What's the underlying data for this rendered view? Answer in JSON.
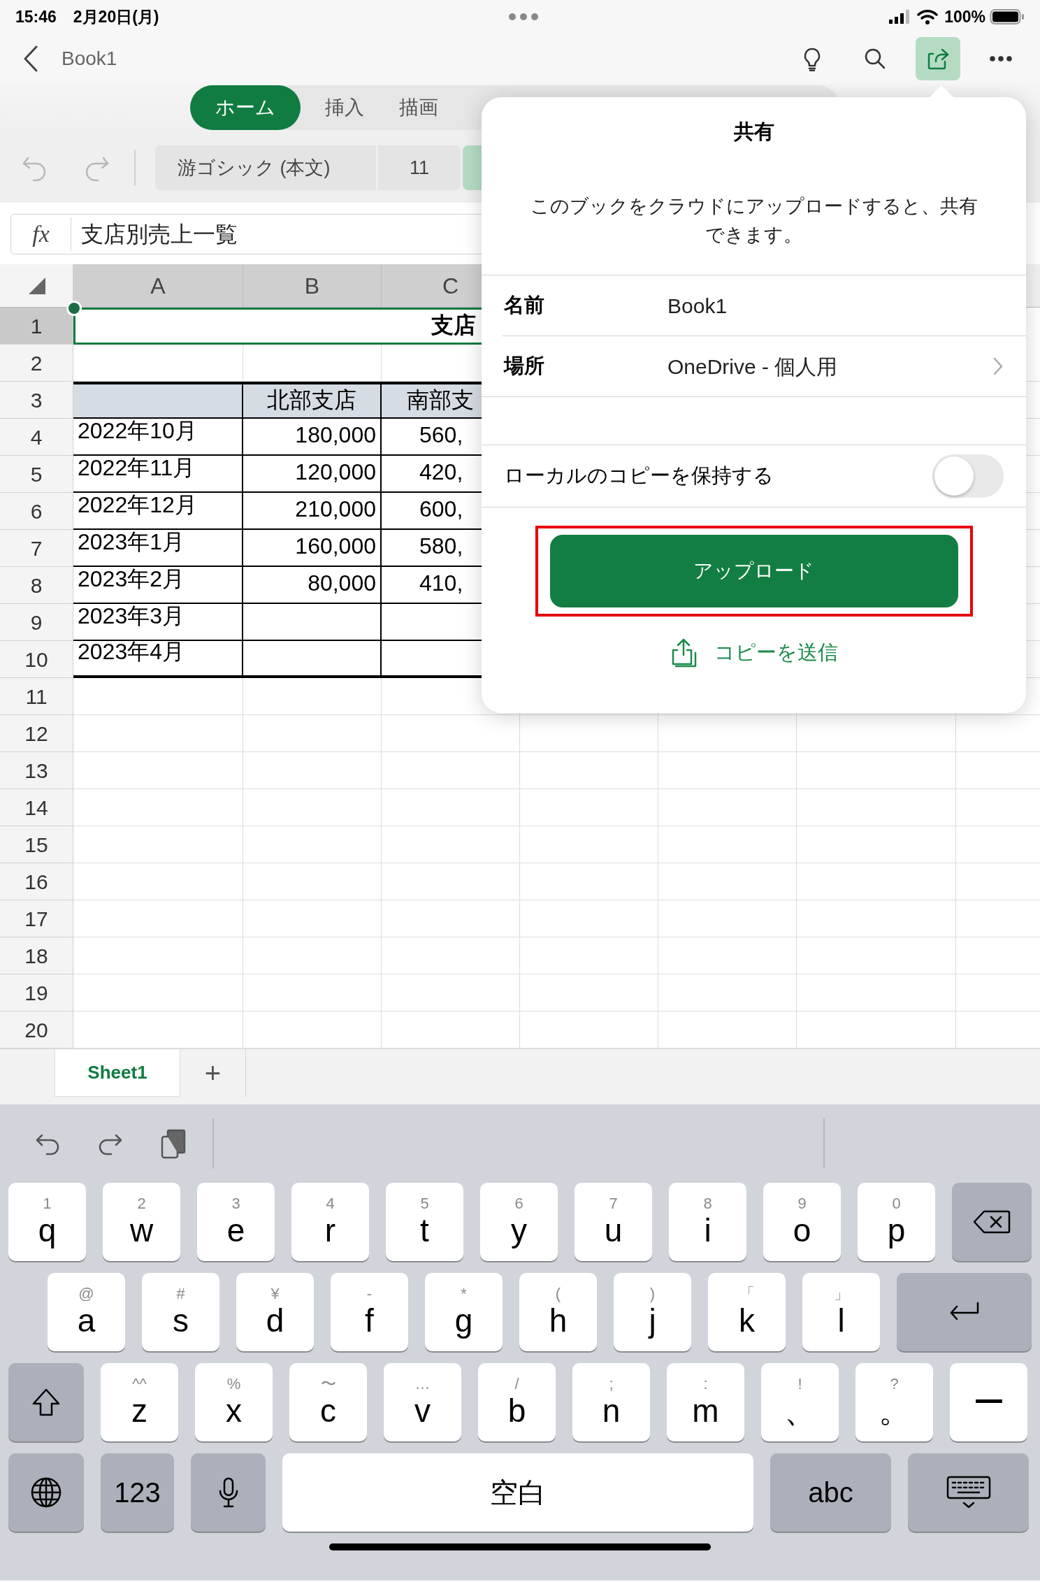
{
  "status_bar": {
    "time": "15:46",
    "date": "2月20日(月)",
    "battery": "100%"
  },
  "nav": {
    "title": "Book1",
    "buttons": [
      {
        "kind": "lightbulb",
        "selected": false
      },
      {
        "kind": "search",
        "selected": false
      },
      {
        "kind": "share",
        "selected": true
      },
      {
        "kind": "more",
        "selected": false
      }
    ]
  },
  "ribbon_tabs": [
    {
      "label": "ホーム",
      "selected": true
    },
    {
      "label": "挿入",
      "selected": false
    },
    {
      "label": "描画",
      "selected": false
    }
  ],
  "toolbar": {
    "font": "游ゴシック (本文)",
    "size": "11"
  },
  "formula_bar": {
    "label": "fx",
    "value": "支店別売上一覧"
  },
  "sheet": {
    "columns": [
      "A",
      "B",
      "C"
    ],
    "rows": [
      {
        "header": "1",
        "kind": "title",
        "selected": true,
        "cells": [
          "",
          "",
          "支店"
        ]
      },
      {
        "header": "2",
        "kind": "blank",
        "selected": false,
        "cells": []
      },
      {
        "header": "3",
        "kind": "header",
        "selected": false,
        "cells": [
          "",
          "北部支店",
          "南部支"
        ]
      },
      {
        "header": "4",
        "kind": "data",
        "selected": false,
        "cells": [
          "2022年10月",
          "180,000",
          "560,"
        ]
      },
      {
        "header": "5",
        "kind": "data",
        "selected": false,
        "cells": [
          "2022年11月",
          "120,000",
          "420,"
        ]
      },
      {
        "header": "6",
        "kind": "data",
        "selected": false,
        "cells": [
          "2022年12月",
          "210,000",
          "600,"
        ]
      },
      {
        "header": "7",
        "kind": "data",
        "selected": false,
        "cells": [
          "2023年1月",
          "160,000",
          "580,"
        ]
      },
      {
        "header": "8",
        "kind": "data",
        "selected": false,
        "cells": [
          "2023年2月",
          "80,000",
          "410,"
        ]
      },
      {
        "header": "9",
        "kind": "data",
        "selected": false,
        "cells": [
          "2023年3月",
          "",
          ""
        ]
      },
      {
        "header": "10",
        "kind": "data",
        "selected": false,
        "cells": [
          "2023年4月",
          "",
          ""
        ]
      },
      {
        "header": "11",
        "kind": "blank",
        "selected": false,
        "cells": []
      },
      {
        "header": "12",
        "kind": "blank",
        "selected": false,
        "cells": []
      },
      {
        "header": "13",
        "kind": "blank",
        "selected": false,
        "cells": []
      },
      {
        "header": "14",
        "kind": "blank",
        "selected": false,
        "cells": []
      },
      {
        "header": "15",
        "kind": "blank",
        "selected": false,
        "cells": []
      },
      {
        "header": "16",
        "kind": "blank",
        "selected": false,
        "cells": []
      },
      {
        "header": "17",
        "kind": "blank",
        "selected": false,
        "cells": []
      },
      {
        "header": "18",
        "kind": "blank",
        "selected": false,
        "cells": []
      },
      {
        "header": "19",
        "kind": "blank",
        "selected": false,
        "cells": []
      },
      {
        "header": "20",
        "kind": "blank",
        "selected": false,
        "cells": []
      }
    ]
  },
  "sheet_tabs": [
    {
      "label": "Sheet1",
      "selected": true
    }
  ],
  "add_sheet": "+",
  "share_popover": {
    "title": "共有",
    "description": "このブックをクラウドにアップロードすると、共有できます。",
    "fields": [
      {
        "label": "名前",
        "value": "Book1",
        "kind": "plain"
      },
      {
        "label": "場所",
        "value": "OneDrive - 個人用",
        "kind": "link"
      }
    ],
    "keep_local_copy": {
      "label": "ローカルのコピーを保持する",
      "on": false
    },
    "upload_button": {
      "label": "アップロード",
      "highlighted": true
    },
    "send_copy": "コピーを送信"
  },
  "keyboard": {
    "rows": [
      {
        "keys": [
          {
            "kind": "char",
            "hint": "1",
            "label": "q"
          },
          {
            "kind": "char",
            "hint": "2",
            "label": "w"
          },
          {
            "kind": "char",
            "hint": "3",
            "label": "e"
          },
          {
            "kind": "char",
            "hint": "4",
            "label": "r"
          },
          {
            "kind": "char",
            "hint": "5",
            "label": "t"
          },
          {
            "kind": "char",
            "hint": "6",
            "label": "y"
          },
          {
            "kind": "char",
            "hint": "7",
            "label": "u"
          },
          {
            "kind": "char",
            "hint": "8",
            "label": "i"
          },
          {
            "kind": "char",
            "hint": "9",
            "label": "o"
          },
          {
            "kind": "char",
            "hint": "0",
            "label": "p"
          },
          {
            "kind": "backspace"
          }
        ]
      },
      {
        "keys": [
          {
            "kind": "char",
            "hint": "@",
            "label": "a"
          },
          {
            "kind": "char",
            "hint": "#",
            "label": "s"
          },
          {
            "kind": "char",
            "hint": "¥",
            "label": "d"
          },
          {
            "kind": "char",
            "hint": "-",
            "label": "f"
          },
          {
            "kind": "char",
            "hint": "*",
            "label": "g"
          },
          {
            "kind": "char",
            "hint": "(",
            "label": "h"
          },
          {
            "kind": "char",
            "hint": ")",
            "label": "j"
          },
          {
            "kind": "char",
            "hint": "「",
            "label": "k"
          },
          {
            "kind": "char",
            "hint": "」",
            "label": "l"
          },
          {
            "kind": "return"
          }
        ]
      },
      {
        "keys": [
          {
            "kind": "shift"
          },
          {
            "kind": "char",
            "hint": "^^",
            "label": "z"
          },
          {
            "kind": "char",
            "hint": "%",
            "label": "x"
          },
          {
            "kind": "char",
            "hint": "〜",
            "label": "c"
          },
          {
            "kind": "char",
            "hint": "…",
            "label": "v"
          },
          {
            "kind": "char",
            "hint": "/",
            "label": "b"
          },
          {
            "kind": "char",
            "hint": ";",
            "label": "n"
          },
          {
            "kind": "char",
            "hint": ":",
            "label": "m"
          },
          {
            "kind": "char",
            "hint": "!",
            "label": "、"
          },
          {
            "kind": "char",
            "hint": "?",
            "label": "。"
          },
          {
            "kind": "char",
            "label": "ー"
          }
        ]
      },
      {
        "keys": [
          {
            "kind": "globe"
          },
          {
            "kind": "mode",
            "label": "123"
          },
          {
            "kind": "mic"
          },
          {
            "kind": "space",
            "label": "空白"
          },
          {
            "kind": "mode",
            "label": "abc"
          },
          {
            "kind": "hide"
          }
        ]
      }
    ]
  }
}
